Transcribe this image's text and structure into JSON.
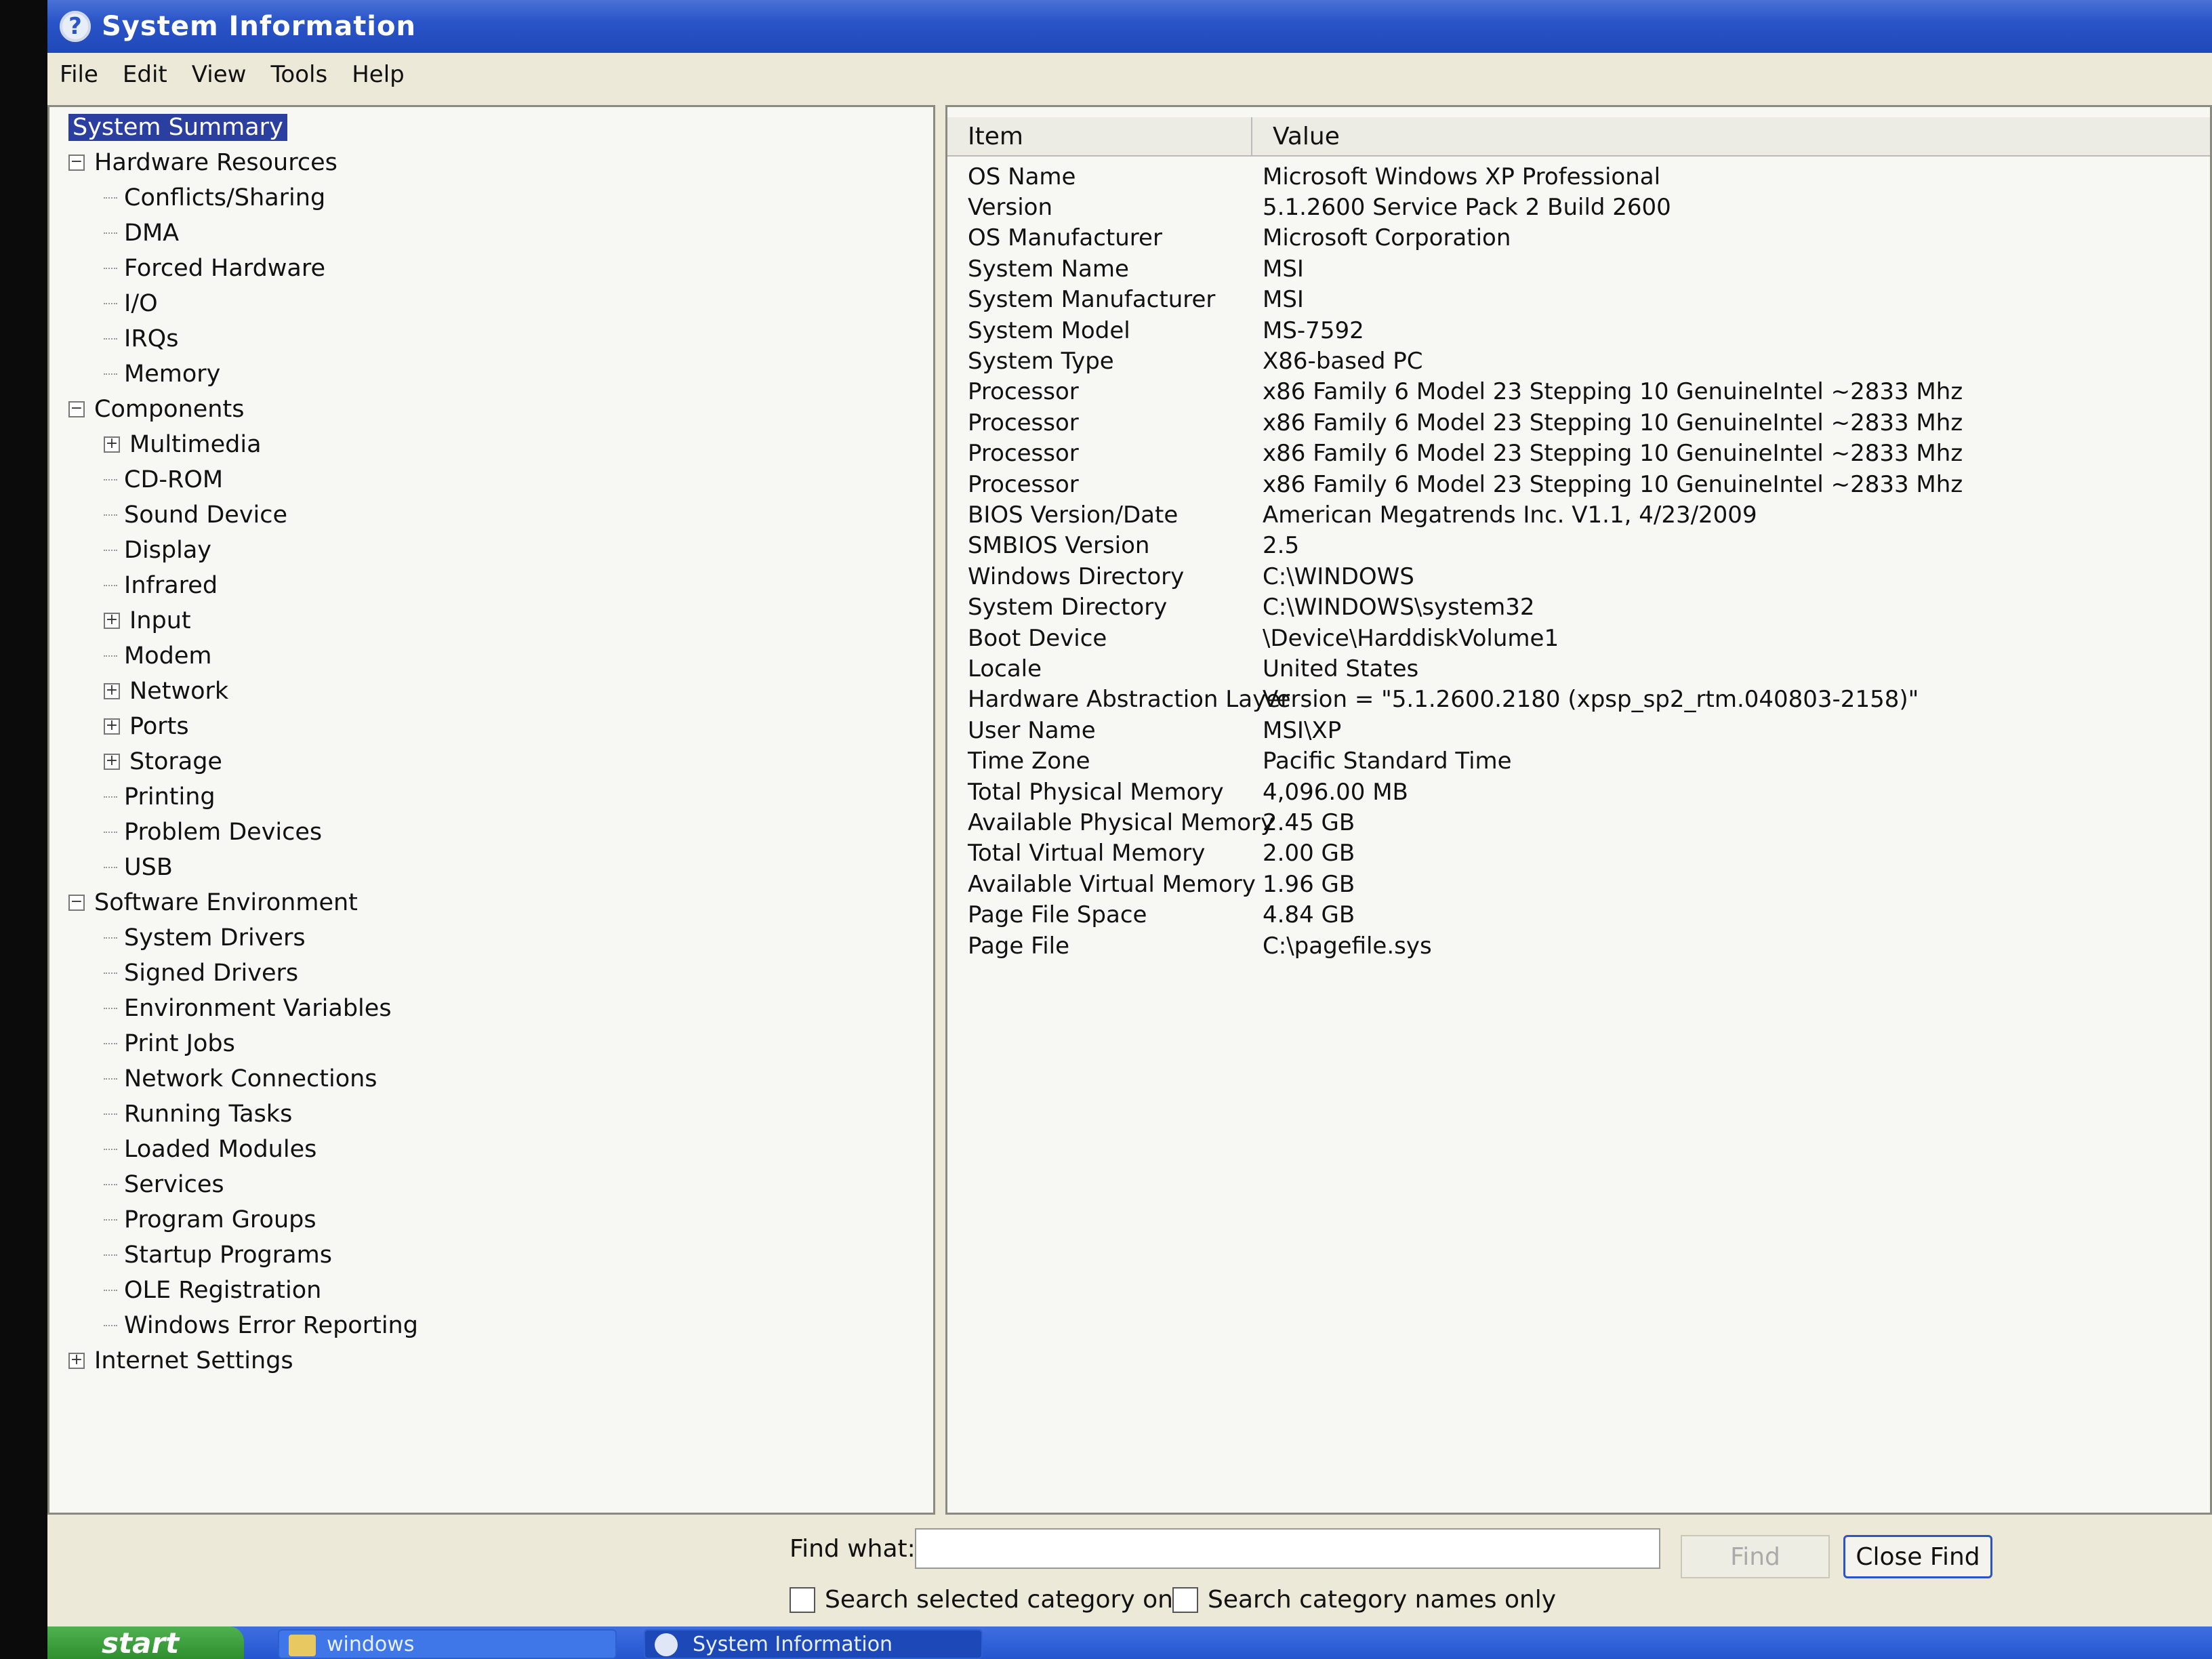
{
  "window": {
    "title": "System Information",
    "title_icon": "help-icon"
  },
  "menu": [
    "File",
    "Edit",
    "View",
    "Tools",
    "Help"
  ],
  "tree": [
    {
      "label": "System Summary",
      "depth": 0,
      "toggle": "",
      "selected": true
    },
    {
      "label": "Hardware Resources",
      "depth": 0,
      "toggle": "−"
    },
    {
      "label": "Conflicts/Sharing",
      "depth": 1,
      "toggle": ""
    },
    {
      "label": "DMA",
      "depth": 1,
      "toggle": ""
    },
    {
      "label": "Forced Hardware",
      "depth": 1,
      "toggle": ""
    },
    {
      "label": "I/O",
      "depth": 1,
      "toggle": ""
    },
    {
      "label": "IRQs",
      "depth": 1,
      "toggle": ""
    },
    {
      "label": "Memory",
      "depth": 1,
      "toggle": ""
    },
    {
      "label": "Components",
      "depth": 0,
      "toggle": "−"
    },
    {
      "label": "Multimedia",
      "depth": 1,
      "toggle": "+"
    },
    {
      "label": "CD-ROM",
      "depth": 1,
      "toggle": ""
    },
    {
      "label": "Sound Device",
      "depth": 1,
      "toggle": ""
    },
    {
      "label": "Display",
      "depth": 1,
      "toggle": ""
    },
    {
      "label": "Infrared",
      "depth": 1,
      "toggle": ""
    },
    {
      "label": "Input",
      "depth": 1,
      "toggle": "+"
    },
    {
      "label": "Modem",
      "depth": 1,
      "toggle": ""
    },
    {
      "label": "Network",
      "depth": 1,
      "toggle": "+"
    },
    {
      "label": "Ports",
      "depth": 1,
      "toggle": "+"
    },
    {
      "label": "Storage",
      "depth": 1,
      "toggle": "+"
    },
    {
      "label": "Printing",
      "depth": 1,
      "toggle": ""
    },
    {
      "label": "Problem Devices",
      "depth": 1,
      "toggle": ""
    },
    {
      "label": "USB",
      "depth": 1,
      "toggle": ""
    },
    {
      "label": "Software Environment",
      "depth": 0,
      "toggle": "−"
    },
    {
      "label": "System Drivers",
      "depth": 1,
      "toggle": ""
    },
    {
      "label": "Signed Drivers",
      "depth": 1,
      "toggle": ""
    },
    {
      "label": "Environment Variables",
      "depth": 1,
      "toggle": ""
    },
    {
      "label": "Print Jobs",
      "depth": 1,
      "toggle": ""
    },
    {
      "label": "Network Connections",
      "depth": 1,
      "toggle": ""
    },
    {
      "label": "Running Tasks",
      "depth": 1,
      "toggle": ""
    },
    {
      "label": "Loaded Modules",
      "depth": 1,
      "toggle": ""
    },
    {
      "label": "Services",
      "depth": 1,
      "toggle": ""
    },
    {
      "label": "Program Groups",
      "depth": 1,
      "toggle": ""
    },
    {
      "label": "Startup Programs",
      "depth": 1,
      "toggle": ""
    },
    {
      "label": "OLE Registration",
      "depth": 1,
      "toggle": ""
    },
    {
      "label": "Windows Error Reporting",
      "depth": 1,
      "toggle": ""
    },
    {
      "label": "Internet Settings",
      "depth": 0,
      "toggle": "+"
    }
  ],
  "table": {
    "headers": {
      "item": "Item",
      "value": "Value"
    },
    "rows": [
      {
        "item": "OS Name",
        "value": "Microsoft Windows XP Professional"
      },
      {
        "item": "Version",
        "value": "5.1.2600 Service Pack 2 Build 2600"
      },
      {
        "item": "OS Manufacturer",
        "value": "Microsoft Corporation"
      },
      {
        "item": "System Name",
        "value": "MSI"
      },
      {
        "item": "System Manufacturer",
        "value": "MSI"
      },
      {
        "item": "System Model",
        "value": "MS-7592"
      },
      {
        "item": "System Type",
        "value": "X86-based PC"
      },
      {
        "item": "Processor",
        "value": "x86 Family 6 Model 23 Stepping 10 GenuineIntel ~2833 Mhz"
      },
      {
        "item": "Processor",
        "value": "x86 Family 6 Model 23 Stepping 10 GenuineIntel ~2833 Mhz"
      },
      {
        "item": "Processor",
        "value": "x86 Family 6 Model 23 Stepping 10 GenuineIntel ~2833 Mhz"
      },
      {
        "item": "Processor",
        "value": "x86 Family 6 Model 23 Stepping 10 GenuineIntel ~2833 Mhz"
      },
      {
        "item": "BIOS Version/Date",
        "value": "American Megatrends Inc. V1.1, 4/23/2009"
      },
      {
        "item": "SMBIOS Version",
        "value": "2.5"
      },
      {
        "item": "Windows Directory",
        "value": "C:\\WINDOWS"
      },
      {
        "item": "System Directory",
        "value": "C:\\WINDOWS\\system32"
      },
      {
        "item": "Boot Device",
        "value": "\\Device\\HarddiskVolume1"
      },
      {
        "item": "Locale",
        "value": "United States"
      },
      {
        "item": "Hardware Abstraction Layer",
        "value": "Version = \"5.1.2600.2180 (xpsp_sp2_rtm.040803-2158)\""
      },
      {
        "item": "User Name",
        "value": "MSI\\XP"
      },
      {
        "item": "Time Zone",
        "value": "Pacific Standard Time"
      },
      {
        "item": "Total Physical Memory",
        "value": "4,096.00 MB"
      },
      {
        "item": "Available Physical Memory",
        "value": "2.45 GB"
      },
      {
        "item": "Total Virtual Memory",
        "value": "2.00 GB"
      },
      {
        "item": "Available Virtual Memory",
        "value": "1.96 GB"
      },
      {
        "item": "Page File Space",
        "value": "4.84 GB"
      },
      {
        "item": "Page File",
        "value": "C:\\pagefile.sys"
      }
    ]
  },
  "find": {
    "label": "Find what:",
    "input_value": "",
    "find_button": "Find",
    "close_button": "Close Find",
    "check_selected": "Search selected category only",
    "check_names": "Search category names only"
  },
  "taskbar": {
    "start": "start",
    "tasks": [
      "windows",
      "System Information"
    ]
  },
  "colors": {
    "titlebar": "#2a55c8",
    "selection": "#2a3fa0",
    "start": "#2f8f2f"
  }
}
